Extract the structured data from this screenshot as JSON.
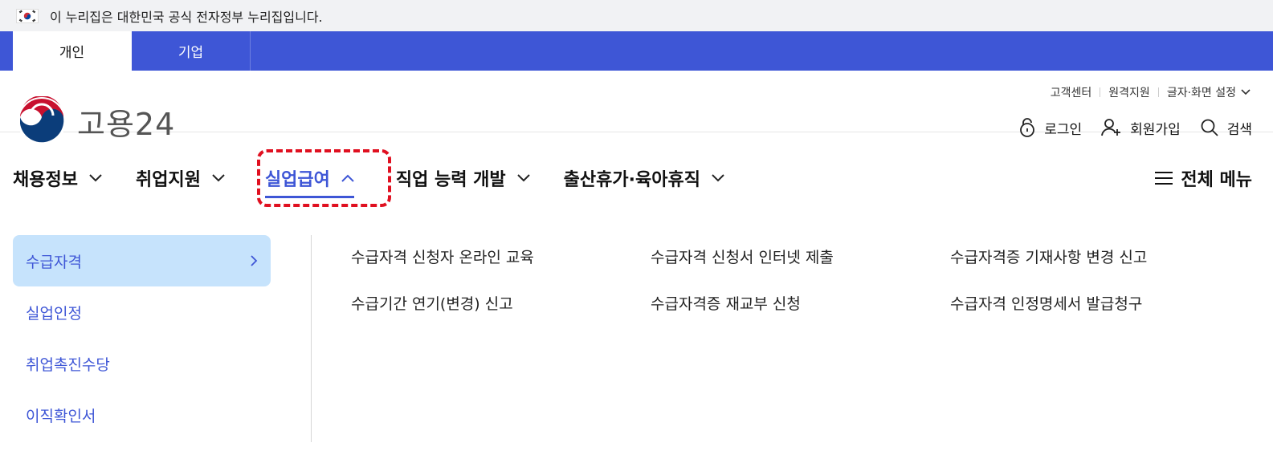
{
  "gov_banner": {
    "text": "이 누리집은 대한민국 공식 전자정부 누리집입니다."
  },
  "type_tabs": [
    {
      "label": "개인",
      "active": true
    },
    {
      "label": "기업",
      "active": false
    }
  ],
  "util_links": {
    "customer_center": "고객센터",
    "remote_support": "원격지원",
    "display_settings": "글자·화면 설정"
  },
  "logo": {
    "text": "고용24"
  },
  "member_links": {
    "login": "로그인",
    "signup": "회원가입",
    "search": "검색"
  },
  "gnb": {
    "items": [
      {
        "label": "채용정보",
        "active": false
      },
      {
        "label": "취업지원",
        "active": false
      },
      {
        "label": "실업급여",
        "active": true
      },
      {
        "label": "직업 능력 개발",
        "active": false
      },
      {
        "label": "출산휴가·육아휴직",
        "active": false
      }
    ],
    "all_menu": "전체 메뉴"
  },
  "side_menu": [
    {
      "label": "수급자격",
      "active": true
    },
    {
      "label": "실업인정",
      "active": false
    },
    {
      "label": "취업촉진수당",
      "active": false
    },
    {
      "label": "이직확인서",
      "active": false
    }
  ],
  "sub_links": [
    "수급자격 신청자 온라인 교육",
    "수급자격 신청서 인터넷 제출",
    "수급자격증 기재사항 변경 신고",
    "수급기간 연기(변경) 신고",
    "수급자격증 재교부 신청",
    "수급자격 인정명세서 발급청구"
  ],
  "colors": {
    "primary": "#3e56d6",
    "active_bg": "#c6e3fc",
    "highlight": "#e01020"
  }
}
